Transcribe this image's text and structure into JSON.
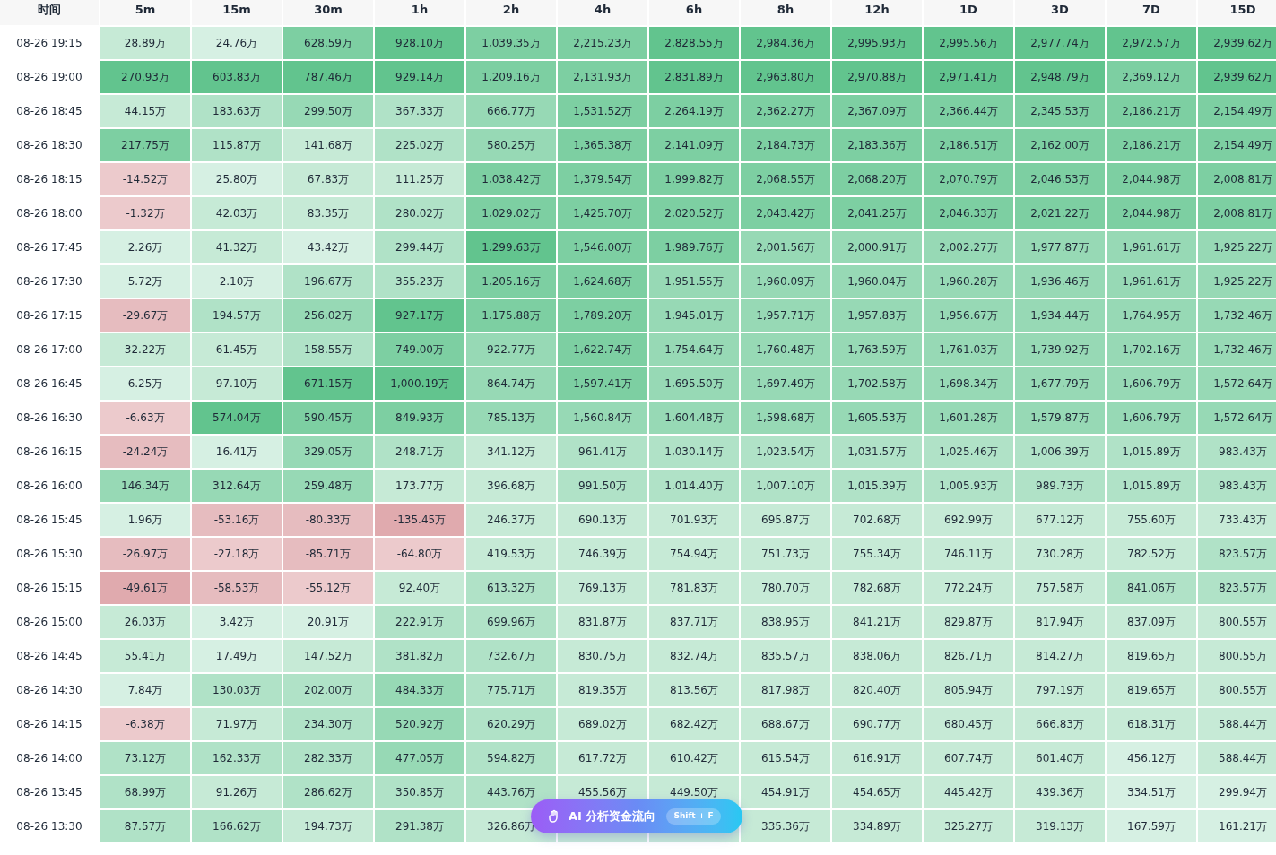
{
  "table": {
    "time_header": "时间",
    "columns": [
      "5m",
      "15m",
      "30m",
      "1h",
      "2h",
      "4h",
      "6h",
      "8h",
      "12h",
      "1D",
      "3D",
      "7D",
      "15D"
    ],
    "rows": [
      {
        "time": "08-26 19:15",
        "cells": [
          {
            "value": "28.89万",
            "color": "#c6ead6"
          },
          {
            "value": "24.76万",
            "color": "#d6f0e3"
          },
          {
            "value": "628.59万",
            "color": "#7dcfa2"
          },
          {
            "value": "928.10万",
            "color": "#62c48e"
          },
          {
            "value": "1,039.35万",
            "color": "#7dcfa2"
          },
          {
            "value": "2,215.23万",
            "color": "#7dcfa2"
          },
          {
            "value": "2,828.55万",
            "color": "#62c48e"
          },
          {
            "value": "2,984.36万",
            "color": "#62c48e"
          },
          {
            "value": "2,995.93万",
            "color": "#62c48e"
          },
          {
            "value": "2,995.56万",
            "color": "#62c48e"
          },
          {
            "value": "2,977.74万",
            "color": "#62c48e"
          },
          {
            "value": "2,972.57万",
            "color": "#62c48e"
          },
          {
            "value": "2,939.62万",
            "color": "#62c48e"
          }
        ]
      },
      {
        "time": "08-26 19:00",
        "cells": [
          {
            "value": "270.93万",
            "color": "#62c48e"
          },
          {
            "value": "603.83万",
            "color": "#62c48e"
          },
          {
            "value": "787.46万",
            "color": "#62c48e"
          },
          {
            "value": "929.14万",
            "color": "#62c48e"
          },
          {
            "value": "1,209.16万",
            "color": "#7dcfa2"
          },
          {
            "value": "2,131.93万",
            "color": "#7dcfa2"
          },
          {
            "value": "2,831.89万",
            "color": "#62c48e"
          },
          {
            "value": "2,963.80万",
            "color": "#62c48e"
          },
          {
            "value": "2,970.88万",
            "color": "#62c48e"
          },
          {
            "value": "2,971.41万",
            "color": "#62c48e"
          },
          {
            "value": "2,948.79万",
            "color": "#62c48e"
          },
          {
            "value": "2,369.12万",
            "color": "#7dcfa2"
          },
          {
            "value": "2,939.62万",
            "color": "#62c48e"
          }
        ]
      },
      {
        "time": "08-26 18:45",
        "cells": [
          {
            "value": "44.15万",
            "color": "#c6ead6"
          },
          {
            "value": "183.63万",
            "color": "#b0e2c7"
          },
          {
            "value": "299.50万",
            "color": "#97d9b5"
          },
          {
            "value": "367.33万",
            "color": "#b0e2c7"
          },
          {
            "value": "666.77万",
            "color": "#97d9b5"
          },
          {
            "value": "1,531.52万",
            "color": "#7dcfa2"
          },
          {
            "value": "2,264.19万",
            "color": "#7dcfa2"
          },
          {
            "value": "2,362.27万",
            "color": "#7dcfa2"
          },
          {
            "value": "2,367.09万",
            "color": "#7dcfa2"
          },
          {
            "value": "2,366.44万",
            "color": "#7dcfa2"
          },
          {
            "value": "2,345.53万",
            "color": "#7dcfa2"
          },
          {
            "value": "2,186.21万",
            "color": "#7dcfa2"
          },
          {
            "value": "2,154.49万",
            "color": "#7dcfa2"
          }
        ]
      },
      {
        "time": "08-26 18:30",
        "cells": [
          {
            "value": "217.75万",
            "color": "#7dcfa2"
          },
          {
            "value": "115.87万",
            "color": "#b0e2c7"
          },
          {
            "value": "141.68万",
            "color": "#c6ead6"
          },
          {
            "value": "225.02万",
            "color": "#b0e2c7"
          },
          {
            "value": "580.25万",
            "color": "#97d9b5"
          },
          {
            "value": "1,365.38万",
            "color": "#7dcfa2"
          },
          {
            "value": "2,141.09万",
            "color": "#7dcfa2"
          },
          {
            "value": "2,184.73万",
            "color": "#7dcfa2"
          },
          {
            "value": "2,183.36万",
            "color": "#7dcfa2"
          },
          {
            "value": "2,186.51万",
            "color": "#7dcfa2"
          },
          {
            "value": "2,162.00万",
            "color": "#7dcfa2"
          },
          {
            "value": "2,186.21万",
            "color": "#7dcfa2"
          },
          {
            "value": "2,154.49万",
            "color": "#7dcfa2"
          }
        ]
      },
      {
        "time": "08-26 18:15",
        "cells": [
          {
            "value": "-14.52万",
            "color": "#eccacc"
          },
          {
            "value": "25.80万",
            "color": "#d6f0e3"
          },
          {
            "value": "67.83万",
            "color": "#c6ead6"
          },
          {
            "value": "111.25万",
            "color": "#c6ead6"
          },
          {
            "value": "1,038.42万",
            "color": "#7dcfa2"
          },
          {
            "value": "1,379.54万",
            "color": "#7dcfa2"
          },
          {
            "value": "1,999.82万",
            "color": "#7dcfa2"
          },
          {
            "value": "2,068.55万",
            "color": "#7dcfa2"
          },
          {
            "value": "2,068.20万",
            "color": "#7dcfa2"
          },
          {
            "value": "2,070.79万",
            "color": "#7dcfa2"
          },
          {
            "value": "2,046.53万",
            "color": "#7dcfa2"
          },
          {
            "value": "2,044.98万",
            "color": "#7dcfa2"
          },
          {
            "value": "2,008.81万",
            "color": "#7dcfa2"
          }
        ]
      },
      {
        "time": "08-26 18:00",
        "cells": [
          {
            "value": "-1.32万",
            "color": "#eccacc"
          },
          {
            "value": "42.03万",
            "color": "#c6ead6"
          },
          {
            "value": "83.35万",
            "color": "#c6ead6"
          },
          {
            "value": "280.02万",
            "color": "#b0e2c7"
          },
          {
            "value": "1,029.02万",
            "color": "#7dcfa2"
          },
          {
            "value": "1,425.70万",
            "color": "#7dcfa2"
          },
          {
            "value": "2,020.52万",
            "color": "#7dcfa2"
          },
          {
            "value": "2,043.42万",
            "color": "#7dcfa2"
          },
          {
            "value": "2,041.25万",
            "color": "#7dcfa2"
          },
          {
            "value": "2,046.33万",
            "color": "#7dcfa2"
          },
          {
            "value": "2,021.22万",
            "color": "#7dcfa2"
          },
          {
            "value": "2,044.98万",
            "color": "#7dcfa2"
          },
          {
            "value": "2,008.81万",
            "color": "#7dcfa2"
          }
        ]
      },
      {
        "time": "08-26 17:45",
        "cells": [
          {
            "value": "2.26万",
            "color": "#d6f0e3"
          },
          {
            "value": "41.32万",
            "color": "#c6ead6"
          },
          {
            "value": "43.42万",
            "color": "#d6f0e3"
          },
          {
            "value": "299.44万",
            "color": "#b0e2c7"
          },
          {
            "value": "1,299.63万",
            "color": "#62c48e"
          },
          {
            "value": "1,546.00万",
            "color": "#7dcfa2"
          },
          {
            "value": "1,989.76万",
            "color": "#7dcfa2"
          },
          {
            "value": "2,001.56万",
            "color": "#97d9b5"
          },
          {
            "value": "2,000.91万",
            "color": "#97d9b5"
          },
          {
            "value": "2,002.27万",
            "color": "#97d9b5"
          },
          {
            "value": "1,977.87万",
            "color": "#97d9b5"
          },
          {
            "value": "1,961.61万",
            "color": "#97d9b5"
          },
          {
            "value": "1,925.22万",
            "color": "#97d9b5"
          }
        ]
      },
      {
        "time": "08-26 17:30",
        "cells": [
          {
            "value": "5.72万",
            "color": "#d6f0e3"
          },
          {
            "value": "2.10万",
            "color": "#d6f0e3"
          },
          {
            "value": "196.67万",
            "color": "#b0e2c7"
          },
          {
            "value": "355.23万",
            "color": "#b0e2c7"
          },
          {
            "value": "1,205.16万",
            "color": "#7dcfa2"
          },
          {
            "value": "1,624.68万",
            "color": "#7dcfa2"
          },
          {
            "value": "1,951.55万",
            "color": "#97d9b5"
          },
          {
            "value": "1,960.09万",
            "color": "#97d9b5"
          },
          {
            "value": "1,960.04万",
            "color": "#97d9b5"
          },
          {
            "value": "1,960.28万",
            "color": "#97d9b5"
          },
          {
            "value": "1,936.46万",
            "color": "#97d9b5"
          },
          {
            "value": "1,961.61万",
            "color": "#97d9b5"
          },
          {
            "value": "1,925.22万",
            "color": "#97d9b5"
          }
        ]
      },
      {
        "time": "08-26 17:15",
        "cells": [
          {
            "value": "-29.67万",
            "color": "#e6bcbf"
          },
          {
            "value": "194.57万",
            "color": "#b0e2c7"
          },
          {
            "value": "256.02万",
            "color": "#97d9b5"
          },
          {
            "value": "927.17万",
            "color": "#62c48e"
          },
          {
            "value": "1,175.88万",
            "color": "#7dcfa2"
          },
          {
            "value": "1,789.20万",
            "color": "#7dcfa2"
          },
          {
            "value": "1,945.01万",
            "color": "#97d9b5"
          },
          {
            "value": "1,957.71万",
            "color": "#97d9b5"
          },
          {
            "value": "1,957.83万",
            "color": "#97d9b5"
          },
          {
            "value": "1,956.67万",
            "color": "#97d9b5"
          },
          {
            "value": "1,934.44万",
            "color": "#97d9b5"
          },
          {
            "value": "1,764.95万",
            "color": "#97d9b5"
          },
          {
            "value": "1,732.46万",
            "color": "#97d9b5"
          }
        ]
      },
      {
        "time": "08-26 17:00",
        "cells": [
          {
            "value": "32.22万",
            "color": "#c6ead6"
          },
          {
            "value": "61.45万",
            "color": "#c6ead6"
          },
          {
            "value": "158.55万",
            "color": "#b0e2c7"
          },
          {
            "value": "749.00万",
            "color": "#7dcfa2"
          },
          {
            "value": "922.77万",
            "color": "#97d9b5"
          },
          {
            "value": "1,622.74万",
            "color": "#7dcfa2"
          },
          {
            "value": "1,754.64万",
            "color": "#97d9b5"
          },
          {
            "value": "1,760.48万",
            "color": "#97d9b5"
          },
          {
            "value": "1,763.59万",
            "color": "#97d9b5"
          },
          {
            "value": "1,761.03万",
            "color": "#97d9b5"
          },
          {
            "value": "1,739.92万",
            "color": "#97d9b5"
          },
          {
            "value": "1,702.16万",
            "color": "#97d9b5"
          },
          {
            "value": "1,732.46万",
            "color": "#97d9b5"
          }
        ]
      },
      {
        "time": "08-26 16:45",
        "cells": [
          {
            "value": "6.25万",
            "color": "#d6f0e3"
          },
          {
            "value": "97.10万",
            "color": "#c6ead6"
          },
          {
            "value": "671.15万",
            "color": "#62c48e"
          },
          {
            "value": "1,000.19万",
            "color": "#62c48e"
          },
          {
            "value": "864.74万",
            "color": "#97d9b5"
          },
          {
            "value": "1,597.41万",
            "color": "#7dcfa2"
          },
          {
            "value": "1,695.50万",
            "color": "#97d9b5"
          },
          {
            "value": "1,697.49万",
            "color": "#97d9b5"
          },
          {
            "value": "1,702.58万",
            "color": "#97d9b5"
          },
          {
            "value": "1,698.34万",
            "color": "#97d9b5"
          },
          {
            "value": "1,677.79万",
            "color": "#97d9b5"
          },
          {
            "value": "1,606.79万",
            "color": "#97d9b5"
          },
          {
            "value": "1,572.64万",
            "color": "#97d9b5"
          }
        ]
      },
      {
        "time": "08-26 16:30",
        "cells": [
          {
            "value": "-6.63万",
            "color": "#eccacc"
          },
          {
            "value": "574.04万",
            "color": "#62c48e"
          },
          {
            "value": "590.45万",
            "color": "#7dcfa2"
          },
          {
            "value": "849.93万",
            "color": "#7dcfa2"
          },
          {
            "value": "785.13万",
            "color": "#97d9b5"
          },
          {
            "value": "1,560.84万",
            "color": "#97d9b5"
          },
          {
            "value": "1,604.48万",
            "color": "#97d9b5"
          },
          {
            "value": "1,598.68万",
            "color": "#97d9b5"
          },
          {
            "value": "1,605.53万",
            "color": "#97d9b5"
          },
          {
            "value": "1,601.28万",
            "color": "#97d9b5"
          },
          {
            "value": "1,579.87万",
            "color": "#97d9b5"
          },
          {
            "value": "1,606.79万",
            "color": "#97d9b5"
          },
          {
            "value": "1,572.64万",
            "color": "#97d9b5"
          }
        ]
      },
      {
        "time": "08-26 16:15",
        "cells": [
          {
            "value": "-24.24万",
            "color": "#e6bcbf"
          },
          {
            "value": "16.41万",
            "color": "#d6f0e3"
          },
          {
            "value": "329.05万",
            "color": "#97d9b5"
          },
          {
            "value": "248.71万",
            "color": "#b0e2c7"
          },
          {
            "value": "341.12万",
            "color": "#c6ead6"
          },
          {
            "value": "961.41万",
            "color": "#b0e2c7"
          },
          {
            "value": "1,030.14万",
            "color": "#b0e2c7"
          },
          {
            "value": "1,023.54万",
            "color": "#b0e2c7"
          },
          {
            "value": "1,031.57万",
            "color": "#b0e2c7"
          },
          {
            "value": "1,025.46万",
            "color": "#b0e2c7"
          },
          {
            "value": "1,006.39万",
            "color": "#b0e2c7"
          },
          {
            "value": "1,015.89万",
            "color": "#b0e2c7"
          },
          {
            "value": "983.43万",
            "color": "#b0e2c7"
          }
        ]
      },
      {
        "time": "08-26 16:00",
        "cells": [
          {
            "value": "146.34万",
            "color": "#97d9b5"
          },
          {
            "value": "312.64万",
            "color": "#97d9b5"
          },
          {
            "value": "259.48万",
            "color": "#97d9b5"
          },
          {
            "value": "173.77万",
            "color": "#c6ead6"
          },
          {
            "value": "396.68万",
            "color": "#c6ead6"
          },
          {
            "value": "991.50万",
            "color": "#b0e2c7"
          },
          {
            "value": "1,014.40万",
            "color": "#b0e2c7"
          },
          {
            "value": "1,007.10万",
            "color": "#b0e2c7"
          },
          {
            "value": "1,015.39万",
            "color": "#b0e2c7"
          },
          {
            "value": "1,005.93万",
            "color": "#b0e2c7"
          },
          {
            "value": "989.73万",
            "color": "#b0e2c7"
          },
          {
            "value": "1,015.89万",
            "color": "#b0e2c7"
          },
          {
            "value": "983.43万",
            "color": "#b0e2c7"
          }
        ]
      },
      {
        "time": "08-26 15:45",
        "cells": [
          {
            "value": "1.96万",
            "color": "#d6f0e3"
          },
          {
            "value": "-53.16万",
            "color": "#e6bcbf"
          },
          {
            "value": "-80.33万",
            "color": "#e6bcbf"
          },
          {
            "value": "-135.45万",
            "color": "#e0aaae"
          },
          {
            "value": "246.37万",
            "color": "#c6ead6"
          },
          {
            "value": "690.13万",
            "color": "#c6ead6"
          },
          {
            "value": "701.93万",
            "color": "#c6ead6"
          },
          {
            "value": "695.87万",
            "color": "#c6ead6"
          },
          {
            "value": "702.68万",
            "color": "#c6ead6"
          },
          {
            "value": "692.99万",
            "color": "#c6ead6"
          },
          {
            "value": "677.12万",
            "color": "#c6ead6"
          },
          {
            "value": "755.60万",
            "color": "#c6ead6"
          },
          {
            "value": "733.43万",
            "color": "#c6ead6"
          }
        ]
      },
      {
        "time": "08-26 15:30",
        "cells": [
          {
            "value": "-26.97万",
            "color": "#e6bcbf"
          },
          {
            "value": "-27.18万",
            "color": "#eccacc"
          },
          {
            "value": "-85.71万",
            "color": "#e6bcbf"
          },
          {
            "value": "-64.80万",
            "color": "#eccacc"
          },
          {
            "value": "419.53万",
            "color": "#c6ead6"
          },
          {
            "value": "746.39万",
            "color": "#c6ead6"
          },
          {
            "value": "754.94万",
            "color": "#c6ead6"
          },
          {
            "value": "751.73万",
            "color": "#c6ead6"
          },
          {
            "value": "755.34万",
            "color": "#c6ead6"
          },
          {
            "value": "746.11万",
            "color": "#c6ead6"
          },
          {
            "value": "730.28万",
            "color": "#c6ead6"
          },
          {
            "value": "782.52万",
            "color": "#c6ead6"
          },
          {
            "value": "823.57万",
            "color": "#b0e2c7"
          }
        ]
      },
      {
        "time": "08-26 15:15",
        "cells": [
          {
            "value": "-49.61万",
            "color": "#e0aaae"
          },
          {
            "value": "-58.53万",
            "color": "#e6bcbf"
          },
          {
            "value": "-55.12万",
            "color": "#eccacc"
          },
          {
            "value": "92.40万",
            "color": "#c6ead6"
          },
          {
            "value": "613.32万",
            "color": "#b0e2c7"
          },
          {
            "value": "769.13万",
            "color": "#c6ead6"
          },
          {
            "value": "781.83万",
            "color": "#c6ead6"
          },
          {
            "value": "780.70万",
            "color": "#c6ead6"
          },
          {
            "value": "782.68万",
            "color": "#c6ead6"
          },
          {
            "value": "772.24万",
            "color": "#c6ead6"
          },
          {
            "value": "757.58万",
            "color": "#c6ead6"
          },
          {
            "value": "841.06万",
            "color": "#b0e2c7"
          },
          {
            "value": "823.57万",
            "color": "#b0e2c7"
          }
        ]
      },
      {
        "time": "08-26 15:00",
        "cells": [
          {
            "value": "26.03万",
            "color": "#c6ead6"
          },
          {
            "value": "3.42万",
            "color": "#d6f0e3"
          },
          {
            "value": "20.91万",
            "color": "#d6f0e3"
          },
          {
            "value": "222.91万",
            "color": "#b0e2c7"
          },
          {
            "value": "699.96万",
            "color": "#b0e2c7"
          },
          {
            "value": "831.87万",
            "color": "#c6ead6"
          },
          {
            "value": "837.71万",
            "color": "#c6ead6"
          },
          {
            "value": "838.95万",
            "color": "#c6ead6"
          },
          {
            "value": "841.21万",
            "color": "#c6ead6"
          },
          {
            "value": "829.87万",
            "color": "#c6ead6"
          },
          {
            "value": "817.94万",
            "color": "#c6ead6"
          },
          {
            "value": "837.09万",
            "color": "#c6ead6"
          },
          {
            "value": "800.55万",
            "color": "#c6ead6"
          }
        ]
      },
      {
        "time": "08-26 14:45",
        "cells": [
          {
            "value": "55.41万",
            "color": "#c6ead6"
          },
          {
            "value": "17.49万",
            "color": "#d6f0e3"
          },
          {
            "value": "147.52万",
            "color": "#c6ead6"
          },
          {
            "value": "381.82万",
            "color": "#b0e2c7"
          },
          {
            "value": "732.67万",
            "color": "#b0e2c7"
          },
          {
            "value": "830.75万",
            "color": "#c6ead6"
          },
          {
            "value": "832.74万",
            "color": "#c6ead6"
          },
          {
            "value": "835.57万",
            "color": "#c6ead6"
          },
          {
            "value": "838.06万",
            "color": "#c6ead6"
          },
          {
            "value": "826.71万",
            "color": "#c6ead6"
          },
          {
            "value": "814.27万",
            "color": "#c6ead6"
          },
          {
            "value": "819.65万",
            "color": "#c6ead6"
          },
          {
            "value": "800.55万",
            "color": "#c6ead6"
          }
        ]
      },
      {
        "time": "08-26 14:30",
        "cells": [
          {
            "value": "7.84万",
            "color": "#d6f0e3"
          },
          {
            "value": "130.03万",
            "color": "#b0e2c7"
          },
          {
            "value": "202.00万",
            "color": "#b0e2c7"
          },
          {
            "value": "484.33万",
            "color": "#97d9b5"
          },
          {
            "value": "775.71万",
            "color": "#b0e2c7"
          },
          {
            "value": "819.35万",
            "color": "#c6ead6"
          },
          {
            "value": "813.56万",
            "color": "#c6ead6"
          },
          {
            "value": "817.98万",
            "color": "#c6ead6"
          },
          {
            "value": "820.40万",
            "color": "#c6ead6"
          },
          {
            "value": "805.94万",
            "color": "#c6ead6"
          },
          {
            "value": "797.19万",
            "color": "#c6ead6"
          },
          {
            "value": "819.65万",
            "color": "#c6ead6"
          },
          {
            "value": "800.55万",
            "color": "#c6ead6"
          }
        ]
      },
      {
        "time": "08-26 14:15",
        "cells": [
          {
            "value": "-6.38万",
            "color": "#eccacc"
          },
          {
            "value": "71.97万",
            "color": "#c6ead6"
          },
          {
            "value": "234.30万",
            "color": "#b0e2c7"
          },
          {
            "value": "520.92万",
            "color": "#97d9b5"
          },
          {
            "value": "620.29万",
            "color": "#b0e2c7"
          },
          {
            "value": "689.02万",
            "color": "#c6ead6"
          },
          {
            "value": "682.42万",
            "color": "#c6ead6"
          },
          {
            "value": "688.67万",
            "color": "#c6ead6"
          },
          {
            "value": "690.77万",
            "color": "#c6ead6"
          },
          {
            "value": "680.45万",
            "color": "#c6ead6"
          },
          {
            "value": "666.83万",
            "color": "#c6ead6"
          },
          {
            "value": "618.31万",
            "color": "#c6ead6"
          },
          {
            "value": "588.44万",
            "color": "#c6ead6"
          }
        ]
      },
      {
        "time": "08-26 14:00",
        "cells": [
          {
            "value": "73.12万",
            "color": "#b0e2c7"
          },
          {
            "value": "162.33万",
            "color": "#b0e2c7"
          },
          {
            "value": "282.33万",
            "color": "#b0e2c7"
          },
          {
            "value": "477.05万",
            "color": "#97d9b5"
          },
          {
            "value": "594.82万",
            "color": "#b0e2c7"
          },
          {
            "value": "617.72万",
            "color": "#c6ead6"
          },
          {
            "value": "610.42万",
            "color": "#c6ead6"
          },
          {
            "value": "615.54万",
            "color": "#c6ead6"
          },
          {
            "value": "616.91万",
            "color": "#c6ead6"
          },
          {
            "value": "607.74万",
            "color": "#c6ead6"
          },
          {
            "value": "601.40万",
            "color": "#c6ead6"
          },
          {
            "value": "456.12万",
            "color": "#d6f0e3"
          },
          {
            "value": "588.44万",
            "color": "#c6ead6"
          }
        ]
      },
      {
        "time": "08-26 13:45",
        "cells": [
          {
            "value": "68.99万",
            "color": "#b0e2c7"
          },
          {
            "value": "91.26万",
            "color": "#c6ead6"
          },
          {
            "value": "286.62万",
            "color": "#b0e2c7"
          },
          {
            "value": "350.85万",
            "color": "#b0e2c7"
          },
          {
            "value": "443.76万",
            "color": "#b0e2c7"
          },
          {
            "value": "455.56万",
            "color": "#c6ead6"
          },
          {
            "value": "449.50万",
            "color": "#c6ead6"
          },
          {
            "value": "454.91万",
            "color": "#c6ead6"
          },
          {
            "value": "454.65万",
            "color": "#c6ead6"
          },
          {
            "value": "445.42万",
            "color": "#c6ead6"
          },
          {
            "value": "439.36万",
            "color": "#c6ead6"
          },
          {
            "value": "334.51万",
            "color": "#d6f0e3"
          },
          {
            "value": "299.94万",
            "color": "#d6f0e3"
          }
        ]
      },
      {
        "time": "08-26 13:30",
        "cells": [
          {
            "value": "87.57万",
            "color": "#b0e2c7"
          },
          {
            "value": "166.62万",
            "color": "#b0e2c7"
          },
          {
            "value": "194.73万",
            "color": "#c6ead6"
          },
          {
            "value": "291.38万",
            "color": "#b0e2c7"
          },
          {
            "value": "326.86万",
            "color": "#c6ead6"
          },
          {
            "color": "#c6ead6"
          },
          {
            "color": "#c6ead6"
          },
          {
            "value": "335.36万",
            "color": "#c6ead6"
          },
          {
            "value": "334.89万",
            "color": "#c6ead6"
          },
          {
            "value": "325.27万",
            "color": "#c6ead6"
          },
          {
            "value": "319.13万",
            "color": "#c6ead6"
          },
          {
            "value": "167.59万",
            "color": "#d6f0e3"
          },
          {
            "value": "161.21万",
            "color": "#d6f0e3"
          }
        ]
      }
    ]
  },
  "ai_button": {
    "label": "AI 分析资金流向",
    "shortcut": "Shift + F"
  }
}
